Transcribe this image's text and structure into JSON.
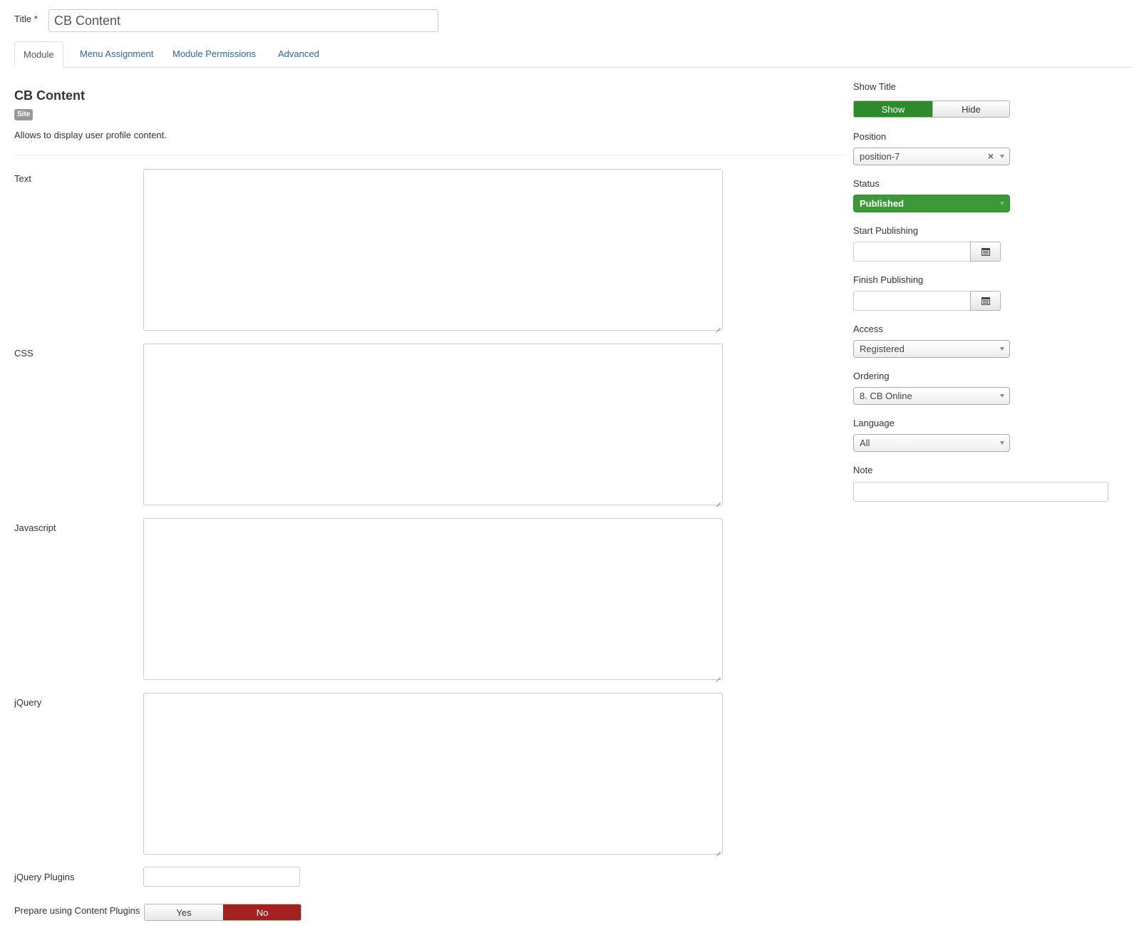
{
  "title_field": {
    "label": "Title *",
    "value": "CB Content"
  },
  "tabs": [
    {
      "label": "Module"
    },
    {
      "label": "Menu Assignment"
    },
    {
      "label": "Module Permissions"
    },
    {
      "label": "Advanced"
    }
  ],
  "module": {
    "name": "CB Content",
    "badge": "Site",
    "description": "Allows to display user profile content."
  },
  "fields": {
    "text_label": "Text",
    "css_label": "CSS",
    "javascript_label": "Javascript",
    "jquery_label": "jQuery",
    "jquery_plugins_label": "jQuery Plugins",
    "prepare_label": "Prepare using Content Plugins",
    "prepare_yes": "Yes",
    "prepare_no": "No"
  },
  "sidebar": {
    "show_title_label": "Show Title",
    "show_label": "Show",
    "hide_label": "Hide",
    "position_label": "Position",
    "position_value": "position-7",
    "clear_symbol": "×",
    "status_label": "Status",
    "status_value": "Published",
    "start_publishing_label": "Start Publishing",
    "finish_publishing_label": "Finish Publishing",
    "access_label": "Access",
    "access_value": "Registered",
    "ordering_label": "Ordering",
    "ordering_value": "8. CB Online",
    "language_label": "Language",
    "language_value": "All",
    "note_label": "Note"
  },
  "colors": {
    "green": "#2f8a2d",
    "red": "#a3221f",
    "link": "#336699"
  }
}
